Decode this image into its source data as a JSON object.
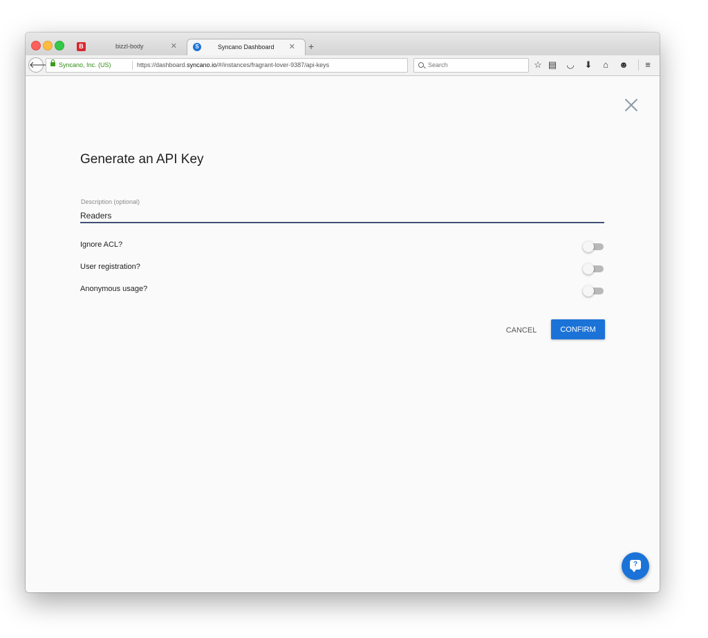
{
  "browser": {
    "tabs": [
      {
        "title": "bizzl-body",
        "favicon": "B",
        "active": false
      },
      {
        "title": "Syncano Dashboard",
        "favicon": "S",
        "active": true
      }
    ],
    "new_tab": "+",
    "close_glyph": "✕",
    "site_identity": "Syncano, Inc. (US)",
    "url_prefix": "https://dashboard.",
    "url_domain": "syncano.io",
    "url_path": "/#/instances/fragrant-lover-9387/api-keys",
    "search_placeholder": "Search",
    "toolbar_icons": [
      "star-icon",
      "reading-list-icon",
      "pocket-icon",
      "download-icon",
      "home-icon",
      "hello-icon",
      "menu-icon"
    ]
  },
  "dialog": {
    "title": "Generate an API Key",
    "description_label": "Description (optional)",
    "description_value": "Readers",
    "toggles": [
      {
        "label": "Ignore ACL?",
        "on": false
      },
      {
        "label": "User registration?",
        "on": false
      },
      {
        "label": "Anonymous usage?",
        "on": false
      }
    ],
    "cancel_label": "CANCEL",
    "confirm_label": "CONFIRM"
  },
  "help": {
    "glyph": "?"
  },
  "colors": {
    "accent": "#1b73d8",
    "input_underline": "#3f4f76",
    "secure_green": "#2f8a14"
  }
}
